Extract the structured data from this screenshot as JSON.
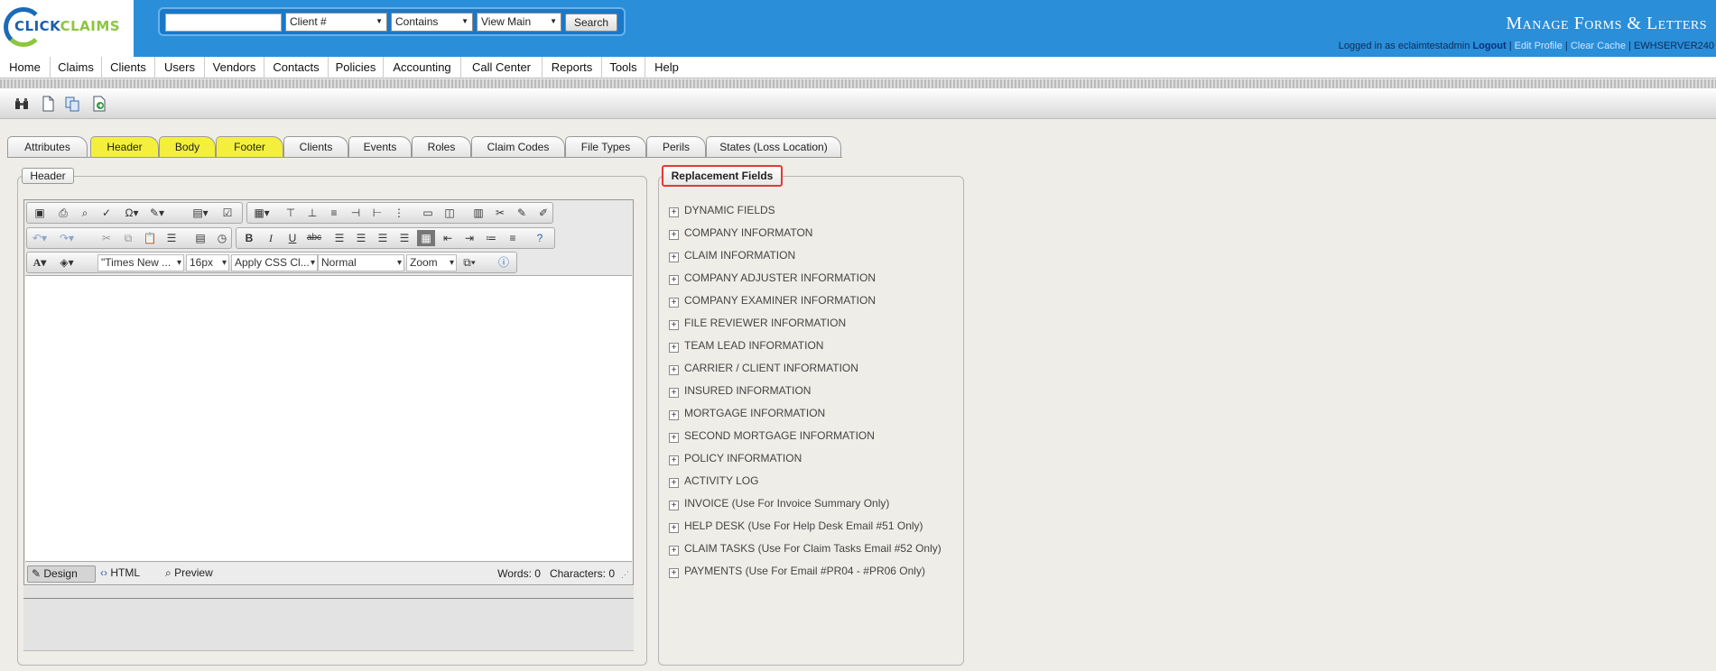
{
  "logo": {
    "part1": "CLICK",
    "part2": "CLAIMS"
  },
  "search": {
    "input_value": "",
    "field_select": "Client #",
    "operator_select": "Contains",
    "view_select": "View Main",
    "button": "Search"
  },
  "header": {
    "title": "Manage Forms & Letters",
    "logged_in_prefix": "Logged in as eclaimtestadmin",
    "logout": "Logout",
    "edit_profile": "Edit Profile",
    "clear_cache": "Clear Cache",
    "server": "EWHSERVER240",
    "separator": "|"
  },
  "nav": [
    "Home",
    "Claims",
    "Clients",
    "Users",
    "Vendors",
    "Contacts",
    "Policies",
    "Accounting",
    "Call Center",
    "Reports",
    "Tools",
    "Help"
  ],
  "toolbar_icons": [
    "binoculars-icon",
    "new-document-icon",
    "copy-document-icon",
    "export-document-icon"
  ],
  "tabs": [
    {
      "label": "Attributes",
      "highlight": false
    },
    {
      "label": "Header",
      "highlight": true
    },
    {
      "label": "Body",
      "highlight": true
    },
    {
      "label": "Footer",
      "highlight": true
    },
    {
      "label": "Clients",
      "highlight": false
    },
    {
      "label": "Events",
      "highlight": false
    },
    {
      "label": "Roles",
      "highlight": false
    },
    {
      "label": "Claim Codes",
      "highlight": false
    },
    {
      "label": "File Types",
      "highlight": false
    },
    {
      "label": "Perils",
      "highlight": false
    },
    {
      "label": "States (Loss Location)",
      "highlight": false
    }
  ],
  "highlight_color": "#f4ef3c",
  "header_panel": {
    "legend": "Header",
    "font_family": "\"Times New ...",
    "font_size": "16px",
    "css_class": "Apply CSS Cl...",
    "paragraph": "Normal",
    "zoom": "Zoom",
    "modes": [
      "Design",
      "HTML",
      "Preview"
    ],
    "words": "Words: 0",
    "characters": "Characters: 0"
  },
  "replacement": {
    "legend": "Replacement Fields",
    "items": [
      "DYNAMIC FIELDS",
      "COMPANY INFORMATON",
      "CLAIM INFORMATION",
      "COMPANY ADJUSTER INFORMATION",
      "COMPANY EXAMINER INFORMATION",
      "FILE REVIEWER INFORMATION",
      "TEAM LEAD INFORMATION",
      "CARRIER / CLIENT INFORMATION",
      "INSURED INFORMATION",
      "MORTGAGE INFORMATION",
      "SECOND MORTGAGE INFORMATION",
      "POLICY INFORMATION",
      "ACTIVITY LOG",
      "INVOICE (Use For Invoice Summary Only)",
      "HELP DESK (Use For Help Desk Email #51 Only)",
      "CLAIM TASKS (Use For Claim Tasks Email #52 Only)",
      "PAYMENTS (Use For Email #PR04 - #PR06 Only)"
    ]
  }
}
